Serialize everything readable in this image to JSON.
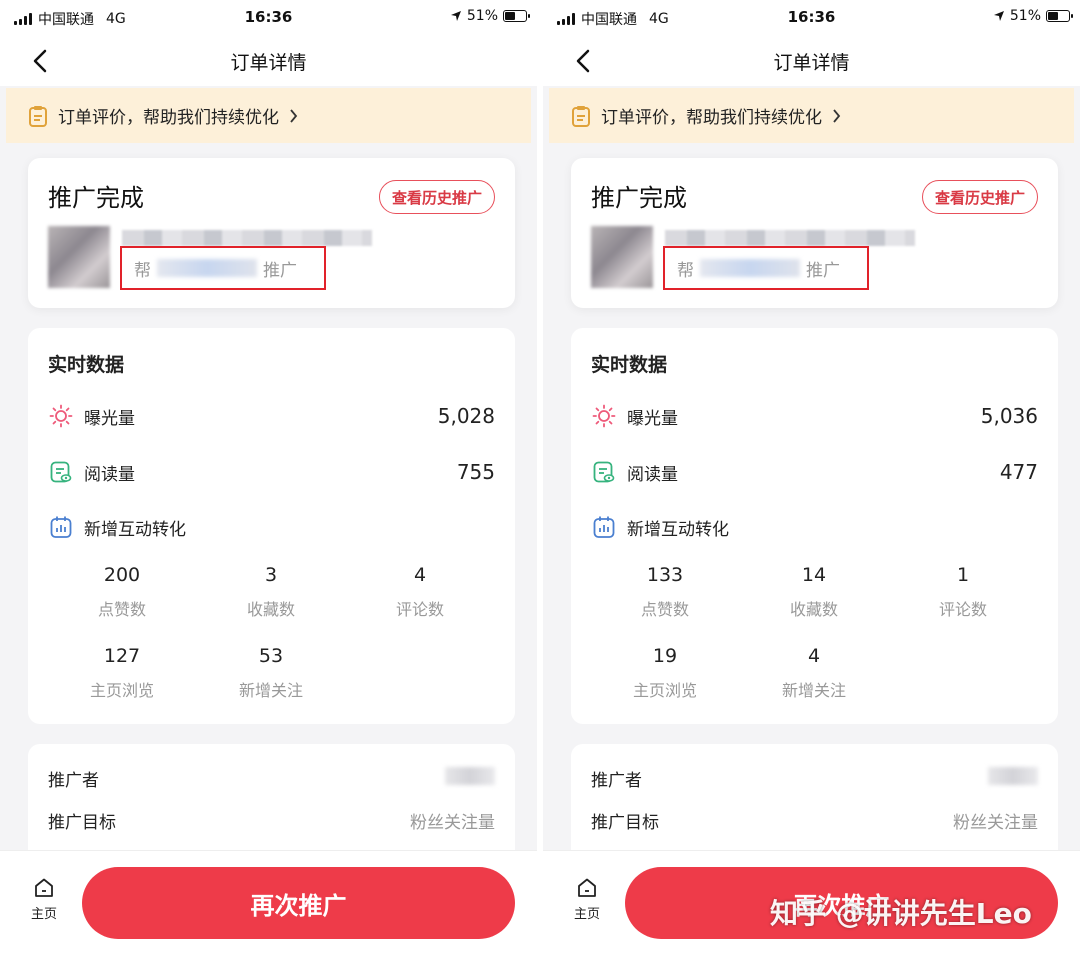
{
  "screens": [
    {
      "status": {
        "carrier": "中国联通",
        "network": "4G",
        "time": "16:36",
        "battery": "51%"
      },
      "nav_title": "订单详情",
      "notice": "订单评价，帮助我们持续优化",
      "card": {
        "title": "推广完成",
        "history_button": "查看历史推广",
        "promo_prefix": "帮",
        "promo_suffix": "推广"
      },
      "realtime": {
        "title": "实时数据",
        "exposure": {
          "label": "曝光量",
          "value": "5,028"
        },
        "reads": {
          "label": "阅读量",
          "value": "755"
        },
        "interaction": {
          "label": "新增互动转化"
        },
        "stats": [
          {
            "num": "200",
            "cap": "点赞数"
          },
          {
            "num": "3",
            "cap": "收藏数"
          },
          {
            "num": "4",
            "cap": "评论数"
          },
          {
            "num": "127",
            "cap": "主页浏览"
          },
          {
            "num": "53",
            "cap": "新增关注"
          }
        ]
      },
      "info": {
        "promoter_label": "推广者",
        "target_label": "推广目标",
        "target_value": "粉丝关注量"
      },
      "bottom": {
        "home": "主页",
        "cta": "再次推广"
      }
    },
    {
      "status": {
        "carrier": "中国联通",
        "network": "4G",
        "time": "16:36",
        "battery": "51%"
      },
      "nav_title": "订单详情",
      "notice": "订单评价，帮助我们持续优化",
      "card": {
        "title": "推广完成",
        "history_button": "查看历史推广",
        "promo_prefix": "帮",
        "promo_suffix": "推广"
      },
      "realtime": {
        "title": "实时数据",
        "exposure": {
          "label": "曝光量",
          "value": "5,036"
        },
        "reads": {
          "label": "阅读量",
          "value": "477"
        },
        "interaction": {
          "label": "新增互动转化"
        },
        "stats": [
          {
            "num": "133",
            "cap": "点赞数"
          },
          {
            "num": "14",
            "cap": "收藏数"
          },
          {
            "num": "1",
            "cap": "评论数"
          },
          {
            "num": "19",
            "cap": "主页浏览"
          },
          {
            "num": "4",
            "cap": "新增关注"
          }
        ]
      },
      "info": {
        "promoter_label": "推广者",
        "target_label": "推广目标",
        "target_value": "粉丝关注量"
      },
      "bottom": {
        "home": "主页",
        "cta": "再次推广"
      }
    }
  ],
  "watermark": "知乎 @讲讲先生Leo"
}
